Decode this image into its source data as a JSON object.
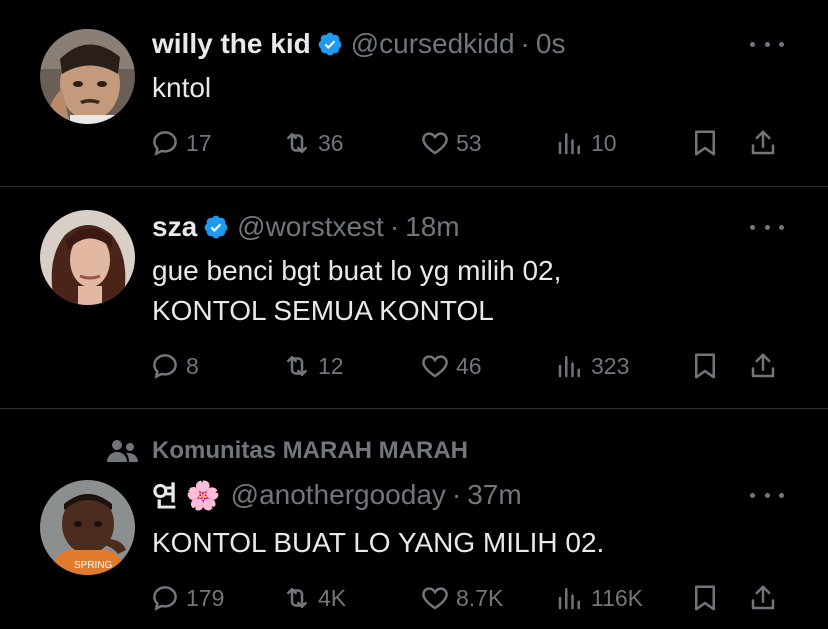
{
  "colors": {
    "background": "#000000",
    "text": "#e7e9ea",
    "muted": "#71767b",
    "verified": "#1d9bf0",
    "divider": "#2f3336"
  },
  "tweets": [
    {
      "name": "willy the kid",
      "verified": true,
      "handle": "@cursedkidd",
      "dot": "·",
      "time": "0s",
      "lines": [
        "kntol"
      ],
      "replies": "17",
      "retweets": "36",
      "likes": "53",
      "views": "10"
    },
    {
      "name": "sza",
      "verified": true,
      "handle": "@worstxest",
      "dot": "·",
      "time": "18m",
      "lines": [
        "gue benci bgt buat lo yg milih 02,",
        "KONTOL SEMUA KONTOL"
      ],
      "replies": "8",
      "retweets": "12",
      "likes": "46",
      "views": "323"
    },
    {
      "community": "Komunitas MARAH MARAH",
      "name": "연",
      "name_emoji": "🌸",
      "verified": false,
      "handle": "@anothergooday",
      "dot": "·",
      "time": "37m",
      "lines": [
        "KONTOL BUAT LO YANG MILIH 02."
      ],
      "replies": "179",
      "retweets": "4K",
      "likes": "8.7K",
      "views": "116K"
    }
  ],
  "icons": [
    "reply-icon",
    "retweet-icon",
    "like-icon",
    "views-icon",
    "bookmark-icon",
    "share-icon",
    "verified-badge-icon",
    "more-icon",
    "community-icon"
  ]
}
